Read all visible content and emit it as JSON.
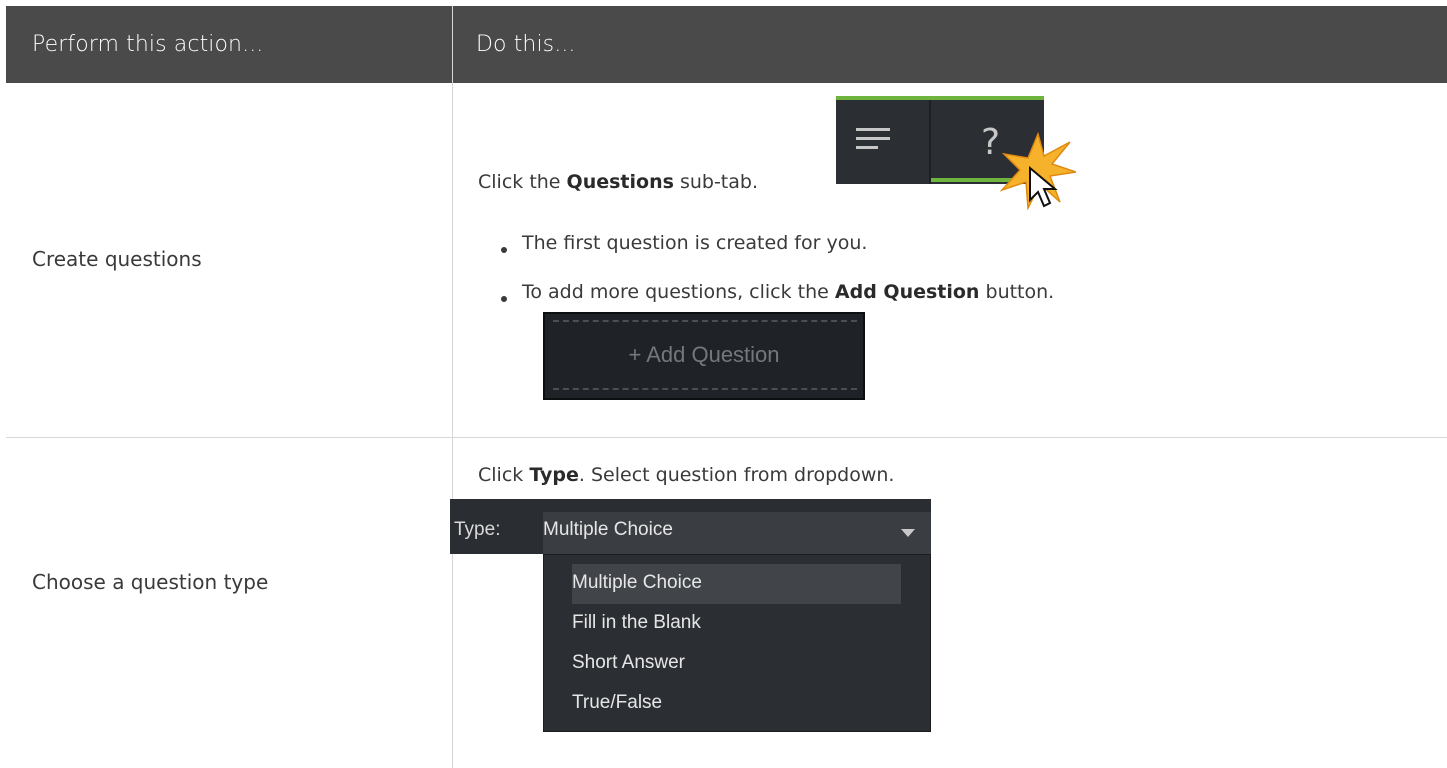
{
  "header": {
    "col1": "Perform this action...",
    "col2": "Do this..."
  },
  "rows": [
    {
      "action": "Create questions",
      "instruction_prefix": "Click the ",
      "instruction_bold": "Questions",
      "instruction_suffix": " sub-tab.",
      "bullets": [
        {
          "text": "The first question is created for you."
        },
        {
          "prefix": "To add more questions, click the ",
          "bold": "Add Question",
          "suffix": " button."
        }
      ],
      "tabs_image": {
        "question_glyph": "?",
        "icons": [
          "menu-icon",
          "question-icon",
          "cursor-click-icon"
        ]
      },
      "add_question_button": "+ Add Question"
    },
    {
      "action": "Choose a question type",
      "instruction_prefix": "Click ",
      "instruction_bold": "Type",
      "instruction_suffix": ". Select question from dropdown.",
      "type_dropdown": {
        "label": "Type:",
        "selected": "Multiple Choice",
        "options": [
          "Multiple Choice",
          "Fill in the Blank",
          "Short Answer",
          "True/False"
        ]
      }
    }
  ],
  "colors": {
    "header_bg": "#4a4a4a",
    "accent_green": "#6fb43f",
    "ui_dark": "#2b2e33"
  }
}
